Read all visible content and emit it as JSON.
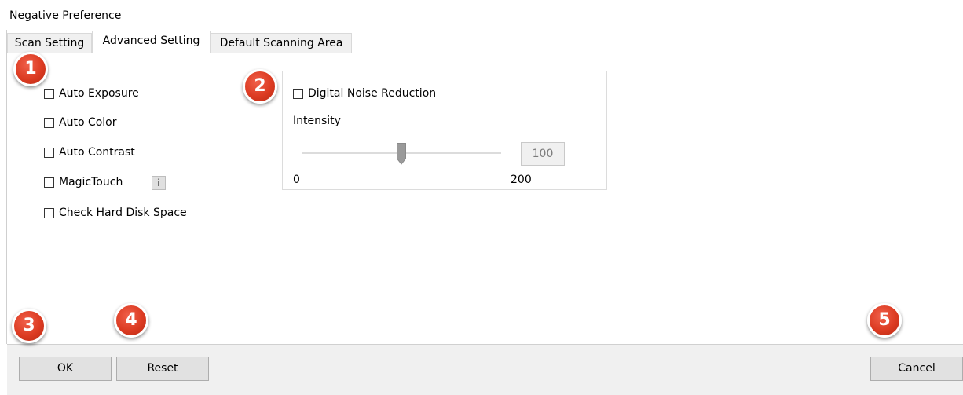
{
  "window": {
    "title": "Negative Preference"
  },
  "tabs": [
    {
      "label": "Scan Setting",
      "active": false
    },
    {
      "label": "Advanced Setting",
      "active": true
    },
    {
      "label": "Default Scanning Area",
      "active": false
    }
  ],
  "options": [
    {
      "label": "Auto Exposure",
      "checked": false
    },
    {
      "label": "Auto Color",
      "checked": false
    },
    {
      "label": "Auto Contrast",
      "checked": false
    },
    {
      "label": "MagicTouch",
      "checked": false
    },
    {
      "label": "Check Hard Disk Space",
      "checked": false
    }
  ],
  "info_button": {
    "label": "i",
    "icon": "info-icon"
  },
  "noise": {
    "label": "Digital Noise Reduction",
    "checked": false,
    "intensity_label": "Intensity",
    "value": "100",
    "min_label": "0",
    "max_label": "200",
    "slider_fraction": 0.5
  },
  "buttons": {
    "ok": "OK",
    "reset": "Reset",
    "cancel": "Cancel"
  },
  "callouts": [
    "1",
    "2",
    "3",
    "4",
    "5"
  ],
  "colors": {
    "callout": "#dc3b22",
    "dialog_bg": "#ffffff",
    "button_bar": "#f0f0f0"
  }
}
